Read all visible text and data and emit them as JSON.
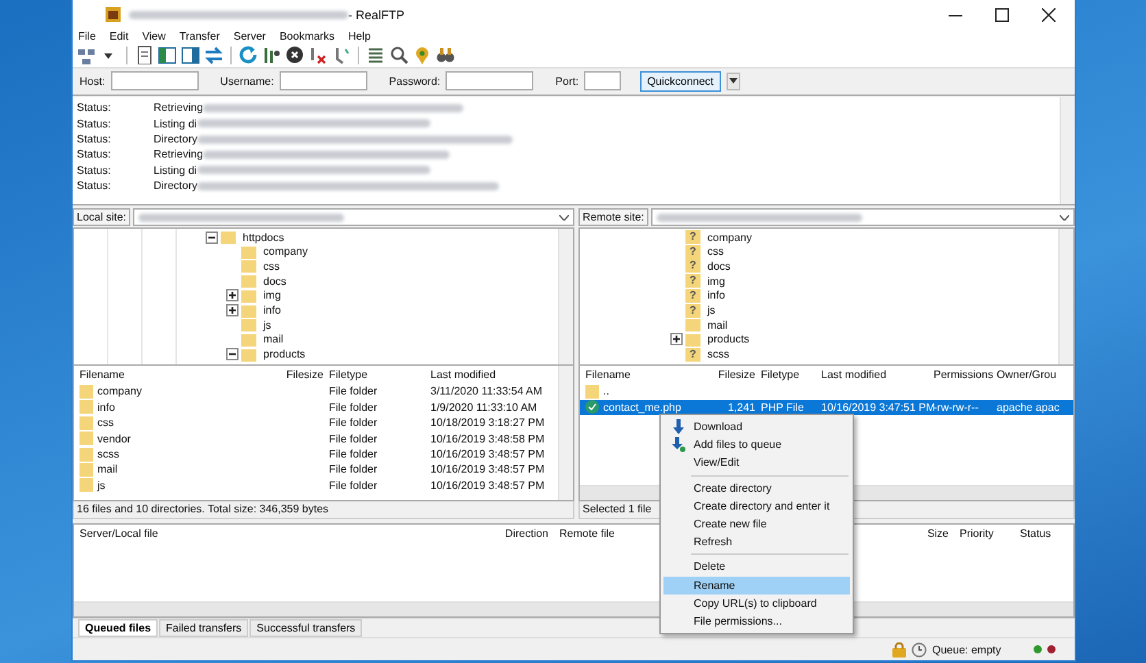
{
  "window": {
    "title": "- RealFTP"
  },
  "menu": [
    "File",
    "Edit",
    "View",
    "Transfer",
    "Server",
    "Bookmarks",
    "Help"
  ],
  "quickconnect": {
    "fields": [
      {
        "label": "Host:"
      },
      {
        "label": "Username:"
      },
      {
        "label": "Password:"
      },
      {
        "label": "Port:"
      }
    ],
    "button": "Quickconnect"
  },
  "log": [
    {
      "label": "Status:",
      "message": "Retrieving"
    },
    {
      "label": "Status:",
      "message": "Listing di"
    },
    {
      "label": "Status:",
      "message": "Directory"
    },
    {
      "label": "Status:",
      "message": "Retrieving"
    },
    {
      "label": "Status:",
      "message": "Listing di"
    },
    {
      "label": "Status:",
      "message": "Directory"
    }
  ],
  "local": {
    "site_label": "Local site:",
    "tree": [
      {
        "name": "httpdocs",
        "kind": "branch",
        "expanded": true,
        "children": [
          {
            "name": "company",
            "kind": "leaf"
          },
          {
            "name": "css",
            "kind": "leaf"
          },
          {
            "name": "docs",
            "kind": "leaf"
          },
          {
            "name": "img",
            "kind": "branch",
            "expanded": false
          },
          {
            "name": "info",
            "kind": "branch",
            "expanded": false
          },
          {
            "name": "js",
            "kind": "leaf"
          },
          {
            "name": "mail",
            "kind": "leaf"
          },
          {
            "name": "products",
            "kind": "branch",
            "expanded": true
          }
        ]
      }
    ],
    "columns": [
      "Filename",
      "Filesize",
      "Filetype",
      "Last modified"
    ],
    "rows": [
      {
        "cells": [
          "company",
          "",
          "File folder",
          "3/11/2020 11:33:54 AM"
        ]
      },
      {
        "cells": [
          "info",
          "",
          "File folder",
          "1/9/2020 11:33:10 AM"
        ]
      },
      {
        "cells": [
          "css",
          "",
          "File folder",
          "10/18/2019 3:18:27 PM"
        ]
      },
      {
        "cells": [
          "vendor",
          "",
          "File folder",
          "10/16/2019 3:48:58 PM"
        ]
      },
      {
        "cells": [
          "scss",
          "",
          "File folder",
          "10/16/2019 3:48:57 PM"
        ]
      },
      {
        "cells": [
          "mail",
          "",
          "File folder",
          "10/16/2019 3:48:57 PM"
        ]
      },
      {
        "cells": [
          "js",
          "",
          "File folder",
          "10/16/2019 3:48:57 PM"
        ]
      }
    ],
    "status": "16 files and 10 directories. Total size: 346,359 bytes"
  },
  "remote": {
    "site_label": "Remote site:",
    "tree": [
      {
        "name": "company",
        "kind": "leaf",
        "badge": "?"
      },
      {
        "name": "css",
        "kind": "leaf",
        "badge": "?"
      },
      {
        "name": "docs",
        "kind": "leaf",
        "badge": "?"
      },
      {
        "name": "img",
        "kind": "leaf",
        "badge": "?"
      },
      {
        "name": "info",
        "kind": "leaf",
        "badge": "?"
      },
      {
        "name": "js",
        "kind": "leaf",
        "badge": "?"
      },
      {
        "name": "mail",
        "kind": "leaf"
      },
      {
        "name": "products",
        "kind": "branch",
        "expanded": false
      },
      {
        "name": "scss",
        "kind": "leaf",
        "badge": "?"
      }
    ],
    "columns": [
      "Filename",
      "Filesize",
      "Filetype",
      "Last modified",
      "Permissions",
      "Owner/Grou"
    ],
    "rows": [
      {
        "kind": "parent",
        "selected": false,
        "cells": [
          "..",
          "",
          "",
          "",
          "",
          ""
        ]
      },
      {
        "kind": "file",
        "selected": true,
        "cells": [
          "contact_me.php",
          "1,241",
          "PHP File",
          "10/16/2019 3:47:51 PM",
          "-rw-rw-r--",
          "apache apac"
        ]
      }
    ],
    "status": "Selected 1 file"
  },
  "context_menu": [
    {
      "kind": "download",
      "label": "Download",
      "selected": false
    },
    {
      "kind": "queue",
      "label": "Add files to queue",
      "selected": false
    },
    {
      "kind": "item",
      "label": "View/Edit",
      "selected": false
    },
    {
      "kind": "separator"
    },
    {
      "kind": "item",
      "label": "Create directory",
      "selected": false
    },
    {
      "kind": "item",
      "label": "Create directory and enter it",
      "selected": false
    },
    {
      "kind": "item",
      "label": "Create new file",
      "selected": false
    },
    {
      "kind": "item",
      "label": "Refresh",
      "selected": false
    },
    {
      "kind": "separator"
    },
    {
      "kind": "item",
      "label": "Delete",
      "selected": false
    },
    {
      "kind": "item",
      "label": "Rename",
      "selected": true
    },
    {
      "kind": "item",
      "label": "Copy URL(s) to clipboard",
      "selected": false
    },
    {
      "kind": "item",
      "label": "File permissions...",
      "selected": false
    }
  ],
  "queue": {
    "columns": [
      "Server/Local file",
      "Direction",
      "Remote file",
      "",
      "Size",
      "Priority",
      "Status"
    ]
  },
  "queue_tabs": [
    {
      "label": "Queued files",
      "selected": true
    },
    {
      "label": "Failed transfers",
      "selected": false
    },
    {
      "label": "Successful transfers",
      "selected": false
    }
  ],
  "status_bar": {
    "queue": "Queue: empty",
    "lights": [
      {
        "color": "#2e9a2e"
      },
      {
        "color": "#a02030"
      }
    ]
  }
}
